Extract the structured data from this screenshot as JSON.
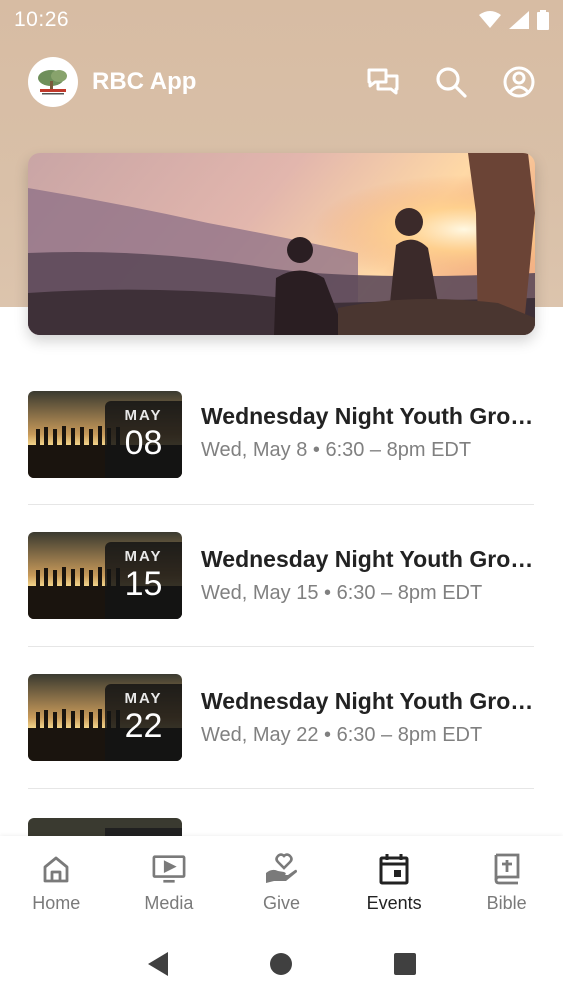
{
  "status_bar": {
    "time": "10:26"
  },
  "header": {
    "title": "RBC App"
  },
  "events": [
    {
      "month": "MAY",
      "day": "08",
      "title": "Wednesday Night Youth Gro…",
      "subtitle": "Wed, May 8 • 6:30 – 8pm EDT"
    },
    {
      "month": "MAY",
      "day": "15",
      "title": "Wednesday Night Youth Gro…",
      "subtitle": "Wed, May 15 • 6:30 – 8pm EDT"
    },
    {
      "month": "MAY",
      "day": "22",
      "title": "Wednesday Night Youth Gro…",
      "subtitle": "Wed, May 22 • 6:30 – 8pm EDT"
    }
  ],
  "tabs": [
    {
      "label": "Home",
      "icon": "home-icon"
    },
    {
      "label": "Media",
      "icon": "media-icon"
    },
    {
      "label": "Give",
      "icon": "give-icon"
    },
    {
      "label": "Events",
      "icon": "events-icon",
      "active": true
    },
    {
      "label": "Bible",
      "icon": "bible-icon"
    }
  ],
  "colors": {
    "header_bg": "#d8bea6",
    "active_tab": "#222222",
    "inactive_tab": "#7a7a7a"
  }
}
